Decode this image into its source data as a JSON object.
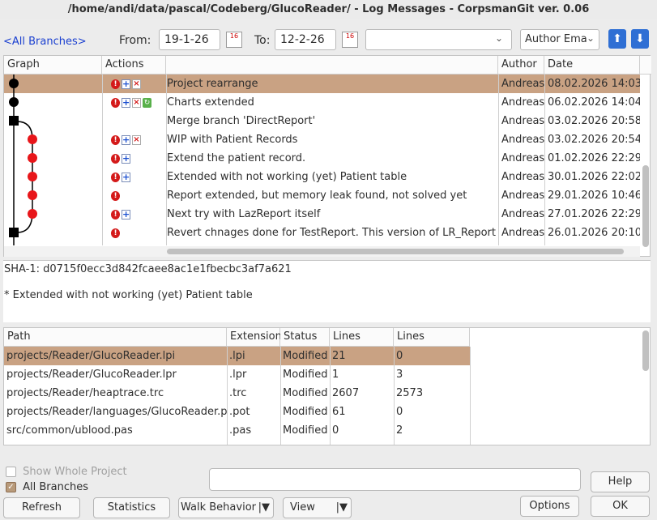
{
  "window": {
    "title": "/home/andi/data/pascal/Codeberg/GlucoReader/ - Log Messages - CorpsmanGit ver. 0.06"
  },
  "toolbar": {
    "branches_link": "<All Branches>",
    "from_label": "From:",
    "from_value": "19-1-26",
    "to_label": "To:",
    "to_value": "12-2-26",
    "calendar_icon_text": "16",
    "filter_value": "",
    "field_selector_value": "Author Ema",
    "up_arrow": "⬆",
    "down_arrow": "⬇"
  },
  "log": {
    "columns": [
      "Graph",
      "Actions",
      "",
      "Author",
      "Date"
    ],
    "rows": [
      {
        "message": "Project rearrange",
        "author": "Andreas",
        "date": "08.02.2026 14:03:",
        "actions": [
          "excl",
          "add",
          "del"
        ],
        "selected": true
      },
      {
        "message": "Charts extended",
        "author": "Andreas",
        "date": "06.02.2026 14:04:",
        "actions": [
          "excl",
          "add",
          "del",
          "ren"
        ]
      },
      {
        "message": "Merge branch 'DirectReport'",
        "author": "Andreas",
        "date": "03.02.2026 20:58:",
        "actions": []
      },
      {
        "message": "WIP with Patient Records",
        "author": "Andreas",
        "date": "03.02.2026 20:54:",
        "actions": [
          "excl",
          "add",
          "del"
        ]
      },
      {
        "message": "Extend the patient record.",
        "author": "Andreas",
        "date": "01.02.2026 22:29:",
        "actions": [
          "excl",
          "add"
        ]
      },
      {
        "message": "Extended with not working (yet) Patient table",
        "author": "Andreas",
        "date": "30.01.2026 22:02:",
        "actions": [
          "excl",
          "add"
        ]
      },
      {
        "message": "Report extended, but memory leak found, not solved yet",
        "author": "Andreas",
        "date": "29.01.2026 10:46:",
        "actions": [
          "excl"
        ]
      },
      {
        "message": "Next try with LazReport itself",
        "author": "Andreas",
        "date": "27.01.2026 22:29:",
        "actions": [
          "excl",
          "add"
        ]
      },
      {
        "message": "Revert chnages done for TestReport. This version of LR_Report is not",
        "author": "Andreas",
        "date": "26.01.2026 20:10:",
        "actions": [
          "excl"
        ]
      }
    ]
  },
  "details": {
    "sha": "SHA-1: d0715f0ecc3d842fcaee8ac1e1fbecbc3af7a621",
    "message": "* Extended with not working (yet) Patient table"
  },
  "files": {
    "columns": [
      "Path",
      "Extension",
      "Status",
      "Lines added",
      "Lines removed"
    ],
    "rows": [
      {
        "path": "projects/Reader/GlucoReader.lpi",
        "ext": ".lpi",
        "status": "Modified",
        "added": "21",
        "removed": "0",
        "selected": true
      },
      {
        "path": "projects/Reader/GlucoReader.lpr",
        "ext": ".lpr",
        "status": "Modified",
        "added": "1",
        "removed": "3"
      },
      {
        "path": "projects/Reader/heaptrace.trc",
        "ext": ".trc",
        "status": "Modified",
        "added": "2607",
        "removed": "2573"
      },
      {
        "path": "projects/Reader/languages/GlucoReader.pot",
        "ext": ".pot",
        "status": "Modified",
        "added": "61",
        "removed": "0"
      },
      {
        "path": "src/common/ublood.pas",
        "ext": ".pas",
        "status": "Modified",
        "added": "0",
        "removed": "2"
      }
    ]
  },
  "bottom": {
    "show_whole_project": "Show Whole Project",
    "all_branches": "All Branches",
    "search_value": "",
    "help": "Help",
    "refresh": "Refresh",
    "statistics": "Statistics",
    "walk_behavior": "Walk Behavior",
    "view": "View",
    "options": "Options",
    "ok": "OK"
  },
  "colors": {
    "selection": "#c9a283",
    "link": "#1a3fd0",
    "node_red": "#e8161a",
    "node_black": "#000000"
  }
}
